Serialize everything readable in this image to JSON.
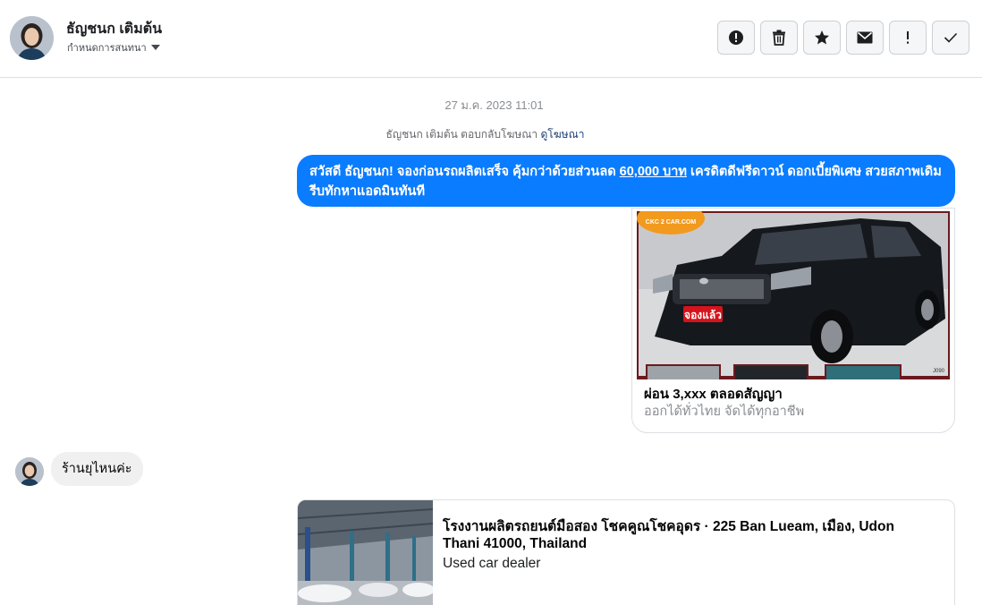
{
  "header": {
    "contact_name": "ธัญชนก เติมต้น",
    "assign_label": "กำหนดการสนทนา",
    "toolbar": {
      "icons": [
        "alert-circle-icon",
        "trash-icon",
        "star-icon",
        "envelope-icon",
        "exclamation-icon",
        "check-icon"
      ]
    }
  },
  "conversation": {
    "timestamp": "27 ม.ค. 2023 11:01",
    "reply_note_text": "ธัญชนก เติมต้น ตอบกลับโฆษณา",
    "reply_note_link": "ดูโฆษณา",
    "outgoing_message": {
      "part1": "สวัสดี ธัญชนก! จองก่อนรถผลิตเสร็จ คุ้มกว่าด้วยส่วนลด ",
      "link": "60,000 บาท",
      "part2": " เครดิตดีฟรีดาวน์ ดอกเบี้ยพิเศษ สวยสภาพเดิม รีบทักหาแอดมินทันที"
    },
    "ad_card": {
      "badge_logo": "CKC 2 CAR.COM",
      "reserved_tag": "จองแล้ว",
      "watermark": "J090",
      "title": "ผ่อน 3,xxx ตลอดสัญญา",
      "subtitle": "ออกได้ทั่วไทย จัดได้ทุกอาชีพ"
    },
    "incoming_message": "ร้านยุไหนค่ะ",
    "place_card": {
      "title": "โรงงานผลิตรถยนต์มือสอง โชคคูณโชคอุดร · 225 Ban Lueam, เมือง, Udon Thani 41000, Thailand",
      "category": "Used car dealer"
    }
  },
  "colors": {
    "outgoing_bubble": "#0a7cff",
    "incoming_bubble": "#f0f0f0",
    "link": "#1c3e74"
  }
}
